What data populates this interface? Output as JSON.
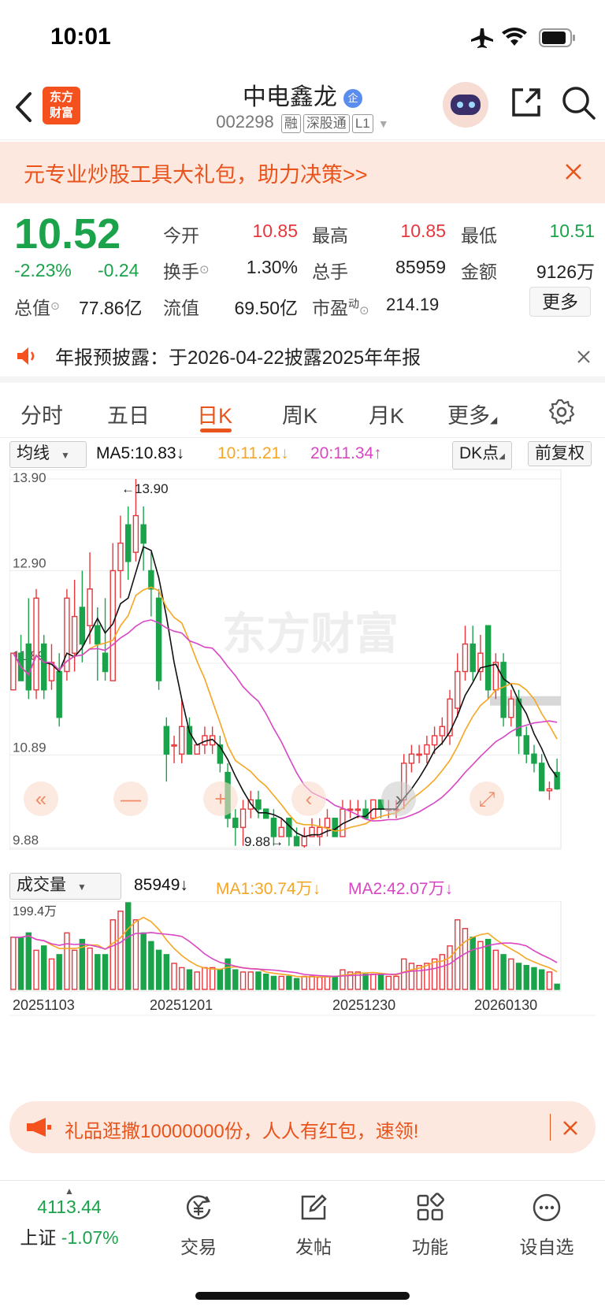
{
  "status": {
    "time": "10:01"
  },
  "nav": {
    "title": "中电鑫龙",
    "code": "002298",
    "tags": [
      "融",
      "深股通",
      "L1"
    ],
    "logo_text_1": "东方",
    "logo_text_2": "财富"
  },
  "banner": {
    "text": "元专业炒股工具大礼包，助力决策>>"
  },
  "quote": {
    "price": "10.52",
    "change_pct": "-2.23%",
    "change": "-0.24",
    "open_label": "今开",
    "open": "10.85",
    "high_label": "最高",
    "high": "10.85",
    "low_label": "最低",
    "low": "10.51",
    "turnover_label": "换手",
    "turnover": "1.30%",
    "volume_label": "总手",
    "volume": "85959",
    "amount_label": "金额",
    "amount": "9126万",
    "mktcap_label": "总值",
    "mktcap": "77.86亿",
    "float_label": "流值",
    "float": "69.50亿",
    "pe_label": "市盈",
    "pe_sup": "动",
    "pe": "214.19",
    "more_label": "更多"
  },
  "notice": {
    "text": "年报预披露：于2026-04-22披露2025年年报"
  },
  "tabs": [
    "分时",
    "五日",
    "日K",
    "周K",
    "月K",
    "更多"
  ],
  "kline_header": {
    "indicator": "均线",
    "ma5": "MA5:10.83↓",
    "ma10": "10:11.21↓",
    "ma20": "20:11.34↑",
    "dk_label": "DK点",
    "adjust_label": "前复权"
  },
  "volume_header": {
    "indicator": "成交量",
    "vol": "85949↓",
    "ma1": "MA1:30.74万↓",
    "ma2": "MA2:42.07万↓",
    "max_label": "199.4万"
  },
  "colors": {
    "up": "#e8373c",
    "down": "#1aa34a",
    "ma5": "#111111",
    "ma10": "#f5a623",
    "ma20": "#d946c4",
    "accent": "#e8541c"
  },
  "chart_data": {
    "type": "candlestick",
    "y_ticks": [
      "13.90",
      "12.90",
      "11.89",
      "10.89",
      "9.88"
    ],
    "ylim": [
      9.88,
      13.9
    ],
    "high_marker": "←13.90",
    "low_marker": "9.88→",
    "x_labels": [
      "20251103",
      "20251201",
      "20251230",
      "20260130"
    ],
    "candles": [
      [
        11.6,
        12.0,
        11.6,
        12.0
      ],
      [
        12.0,
        11.7,
        11.7,
        12.2
      ],
      [
        12.1,
        11.6,
        11.5,
        12.6
      ],
      [
        11.6,
        12.6,
        11.5,
        12.7
      ],
      [
        12.1,
        11.6,
        11.5,
        12.2
      ],
      [
        11.7,
        11.9,
        11.6,
        12.1
      ],
      [
        11.8,
        11.3,
        11.2,
        12.0
      ],
      [
        11.8,
        12.6,
        11.7,
        12.7
      ],
      [
        12.0,
        12.4,
        11.8,
        12.8
      ],
      [
        12.5,
        12.1,
        11.9,
        12.9
      ],
      [
        12.3,
        12.7,
        12.1,
        13.1
      ],
      [
        12.3,
        12.1,
        11.7,
        12.5
      ],
      [
        12.0,
        11.8,
        11.7,
        12.6
      ],
      [
        11.7,
        12.9,
        11.7,
        13.2
      ],
      [
        12.9,
        13.2,
        12.6,
        13.5
      ],
      [
        13.4,
        13.0,
        12.8,
        13.6
      ],
      [
        13.1,
        13.5,
        13.0,
        13.9
      ],
      [
        13.4,
        13.2,
        12.9,
        13.6
      ],
      [
        12.9,
        12.7,
        12.4,
        13.1
      ],
      [
        12.6,
        11.7,
        11.6,
        12.7
      ],
      [
        11.2,
        10.9,
        10.6,
        11.3
      ],
      [
        11.0,
        11.0,
        10.8,
        11.1
      ],
      [
        10.9,
        11.2,
        10.8,
        11.5
      ],
      [
        11.2,
        10.9,
        10.9,
        11.3
      ],
      [
        10.9,
        11.0,
        10.9,
        11.0
      ],
      [
        11.0,
        11.1,
        10.9,
        11.2
      ],
      [
        11.0,
        11.1,
        10.9,
        11.2
      ],
      [
        11.0,
        10.8,
        10.7,
        11.1
      ],
      [
        10.7,
        10.2,
        10.1,
        10.8
      ],
      [
        10.2,
        10.1,
        9.9,
        10.3
      ],
      [
        10.1,
        10.3,
        9.9,
        10.4
      ],
      [
        10.3,
        10.4,
        10.2,
        10.5
      ],
      [
        10.4,
        10.3,
        10.2,
        10.5
      ],
      [
        10.3,
        10.2,
        10.2,
        10.3
      ],
      [
        10.2,
        10.0,
        9.9,
        10.3
      ],
      [
        10.0,
        10.1,
        10.0,
        10.2
      ],
      [
        10.2,
        10.0,
        9.9,
        10.2
      ],
      [
        10.0,
        9.9,
        9.9,
        10.1
      ],
      [
        9.9,
        10.0,
        9.88,
        10.1
      ],
      [
        10.0,
        10.1,
        10.0,
        10.2
      ],
      [
        10.0,
        10.1,
        9.9,
        10.2
      ],
      [
        10.1,
        10.2,
        10.0,
        10.3
      ],
      [
        10.2,
        10.0,
        10.0,
        10.2
      ],
      [
        10.0,
        10.3,
        10.0,
        10.4
      ],
      [
        10.3,
        10.3,
        10.2,
        10.4
      ],
      [
        10.3,
        10.3,
        10.2,
        10.4
      ],
      [
        10.3,
        10.2,
        10.2,
        10.4
      ],
      [
        10.2,
        10.4,
        10.2,
        10.4
      ],
      [
        10.4,
        10.3,
        10.2,
        10.4
      ],
      [
        10.3,
        10.3,
        10.2,
        10.4
      ],
      [
        10.3,
        10.3,
        10.2,
        10.4
      ],
      [
        10.4,
        10.8,
        10.3,
        10.9
      ],
      [
        10.8,
        10.9,
        10.7,
        11.0
      ],
      [
        10.9,
        10.9,
        10.8,
        11.0
      ],
      [
        10.9,
        11.0,
        10.8,
        11.1
      ],
      [
        11.0,
        11.1,
        10.9,
        11.2
      ],
      [
        11.1,
        11.2,
        11.0,
        11.3
      ],
      [
        11.1,
        11.5,
        11.0,
        11.6
      ],
      [
        11.4,
        11.8,
        11.3,
        12.0
      ],
      [
        11.8,
        12.1,
        11.7,
        12.3
      ],
      [
        12.1,
        11.8,
        11.7,
        12.3
      ],
      [
        11.8,
        12.0,
        11.7,
        12.2
      ],
      [
        12.3,
        11.6,
        11.5,
        12.3
      ],
      [
        11.6,
        11.9,
        11.5,
        12.0
      ],
      [
        11.9,
        11.3,
        11.2,
        12.0
      ],
      [
        11.3,
        11.5,
        11.2,
        11.6
      ],
      [
        11.5,
        11.1,
        10.9,
        11.6
      ],
      [
        11.1,
        10.9,
        10.8,
        11.2
      ],
      [
        10.9,
        10.8,
        10.7,
        11.0
      ],
      [
        10.8,
        10.5,
        10.5,
        10.9
      ],
      [
        10.5,
        10.52,
        10.4,
        10.6
      ],
      [
        10.7,
        10.52,
        10.51,
        10.85
      ]
    ],
    "volumes": [
      120,
      120,
      130,
      90,
      100,
      70,
      80,
      130,
      90,
      115,
      95,
      80,
      80,
      160,
      180,
      199.4,
      160,
      130,
      110,
      90,
      80,
      60,
      50,
      45,
      40,
      50,
      50,
      45,
      70,
      45,
      40,
      40,
      40,
      35,
      30,
      30,
      30,
      25,
      30,
      30,
      28,
      30,
      30,
      45,
      40,
      40,
      35,
      35,
      35,
      30,
      30,
      70,
      60,
      55,
      60,
      70,
      80,
      100,
      160,
      140,
      120,
      110,
      115,
      90,
      80,
      70,
      60,
      55,
      50,
      45,
      40,
      12
    ]
  },
  "promo": {
    "text": "礼品逛撒10000000份，人人有红包，速领!"
  },
  "tabbar": {
    "index_value": "4113.44",
    "index_name": "上证",
    "index_change": "-1.07%",
    "items": [
      "交易",
      "发帖",
      "功能",
      "设自选"
    ]
  }
}
